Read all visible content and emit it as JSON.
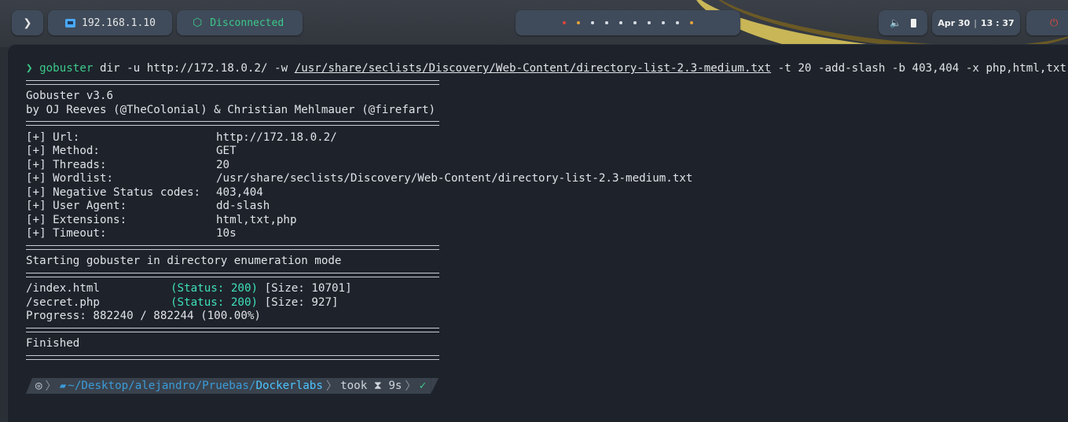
{
  "topbar": {
    "logo_glyph": "❯",
    "ip": "192.168.1.10",
    "vpn_status": "Disconnected",
    "volume_glyph": "🔈",
    "date": "Apr 30",
    "separator": "|",
    "time": "13 : 37",
    "power_glyph": "⏻",
    "workspace_dot_colors": [
      "#e0443a",
      "#e6a23c",
      "#d8dde3",
      "#d8dde3",
      "#d8dde3",
      "#d8dde3",
      "#d8dde3",
      "#d8dde3",
      "#d8dde3",
      "#e6a23c"
    ]
  },
  "terminal": {
    "prompt_arrow": "❯",
    "command_bin": "gobuster",
    "command_part1": " dir -u http://172.18.0.2/ -w ",
    "command_wordlist": "/usr/share/seclists/Discovery/Web-Content/directory-list-2.3-medium.txt",
    "command_part2": " -t 20 -add-slash -b 403,404 -x php,html,txt",
    "banner_version": "Gobuster v3.6",
    "banner_authors": "by OJ Reeves (@TheColonial) & Christian Mehlmauer (@firefart)",
    "config": [
      {
        "key": "[+] Url:",
        "value": "http://172.18.0.2/"
      },
      {
        "key": "[+] Method:",
        "value": "GET"
      },
      {
        "key": "[+] Threads:",
        "value": "20"
      },
      {
        "key": "[+] Wordlist:",
        "value": "/usr/share/seclists/Discovery/Web-Content/directory-list-2.3-medium.txt"
      },
      {
        "key": "[+] Negative Status codes:",
        "value": "403,404"
      },
      {
        "key": "[+] User Agent:",
        "value": "dd-slash"
      },
      {
        "key": "[+] Extensions:",
        "value": "html,txt,php"
      },
      {
        "key": "[+] Timeout:",
        "value": "10s"
      }
    ],
    "starting": "Starting gobuster in directory enumeration mode",
    "results": [
      {
        "path": "/index.html",
        "status": "(Status: 200)",
        "size": " [Size: 10701]"
      },
      {
        "path": "/secret.php",
        "status": "(Status: 200)",
        "size": " [Size: 927]"
      }
    ],
    "progress": "Progress: 882240 / 882244 (100.00%)",
    "finished": "Finished",
    "prompt": {
      "ring_glyph": "◎",
      "folder_glyph": "▰",
      "dir_prefix": "~/Desktop/alejandro/Pruebas/",
      "dir_current": "Dockerlabs",
      "took_label": "took",
      "hourglass_glyph": "⧗",
      "duration": "9s",
      "check_glyph": "✓",
      "chevron_glyph": "〉"
    }
  }
}
